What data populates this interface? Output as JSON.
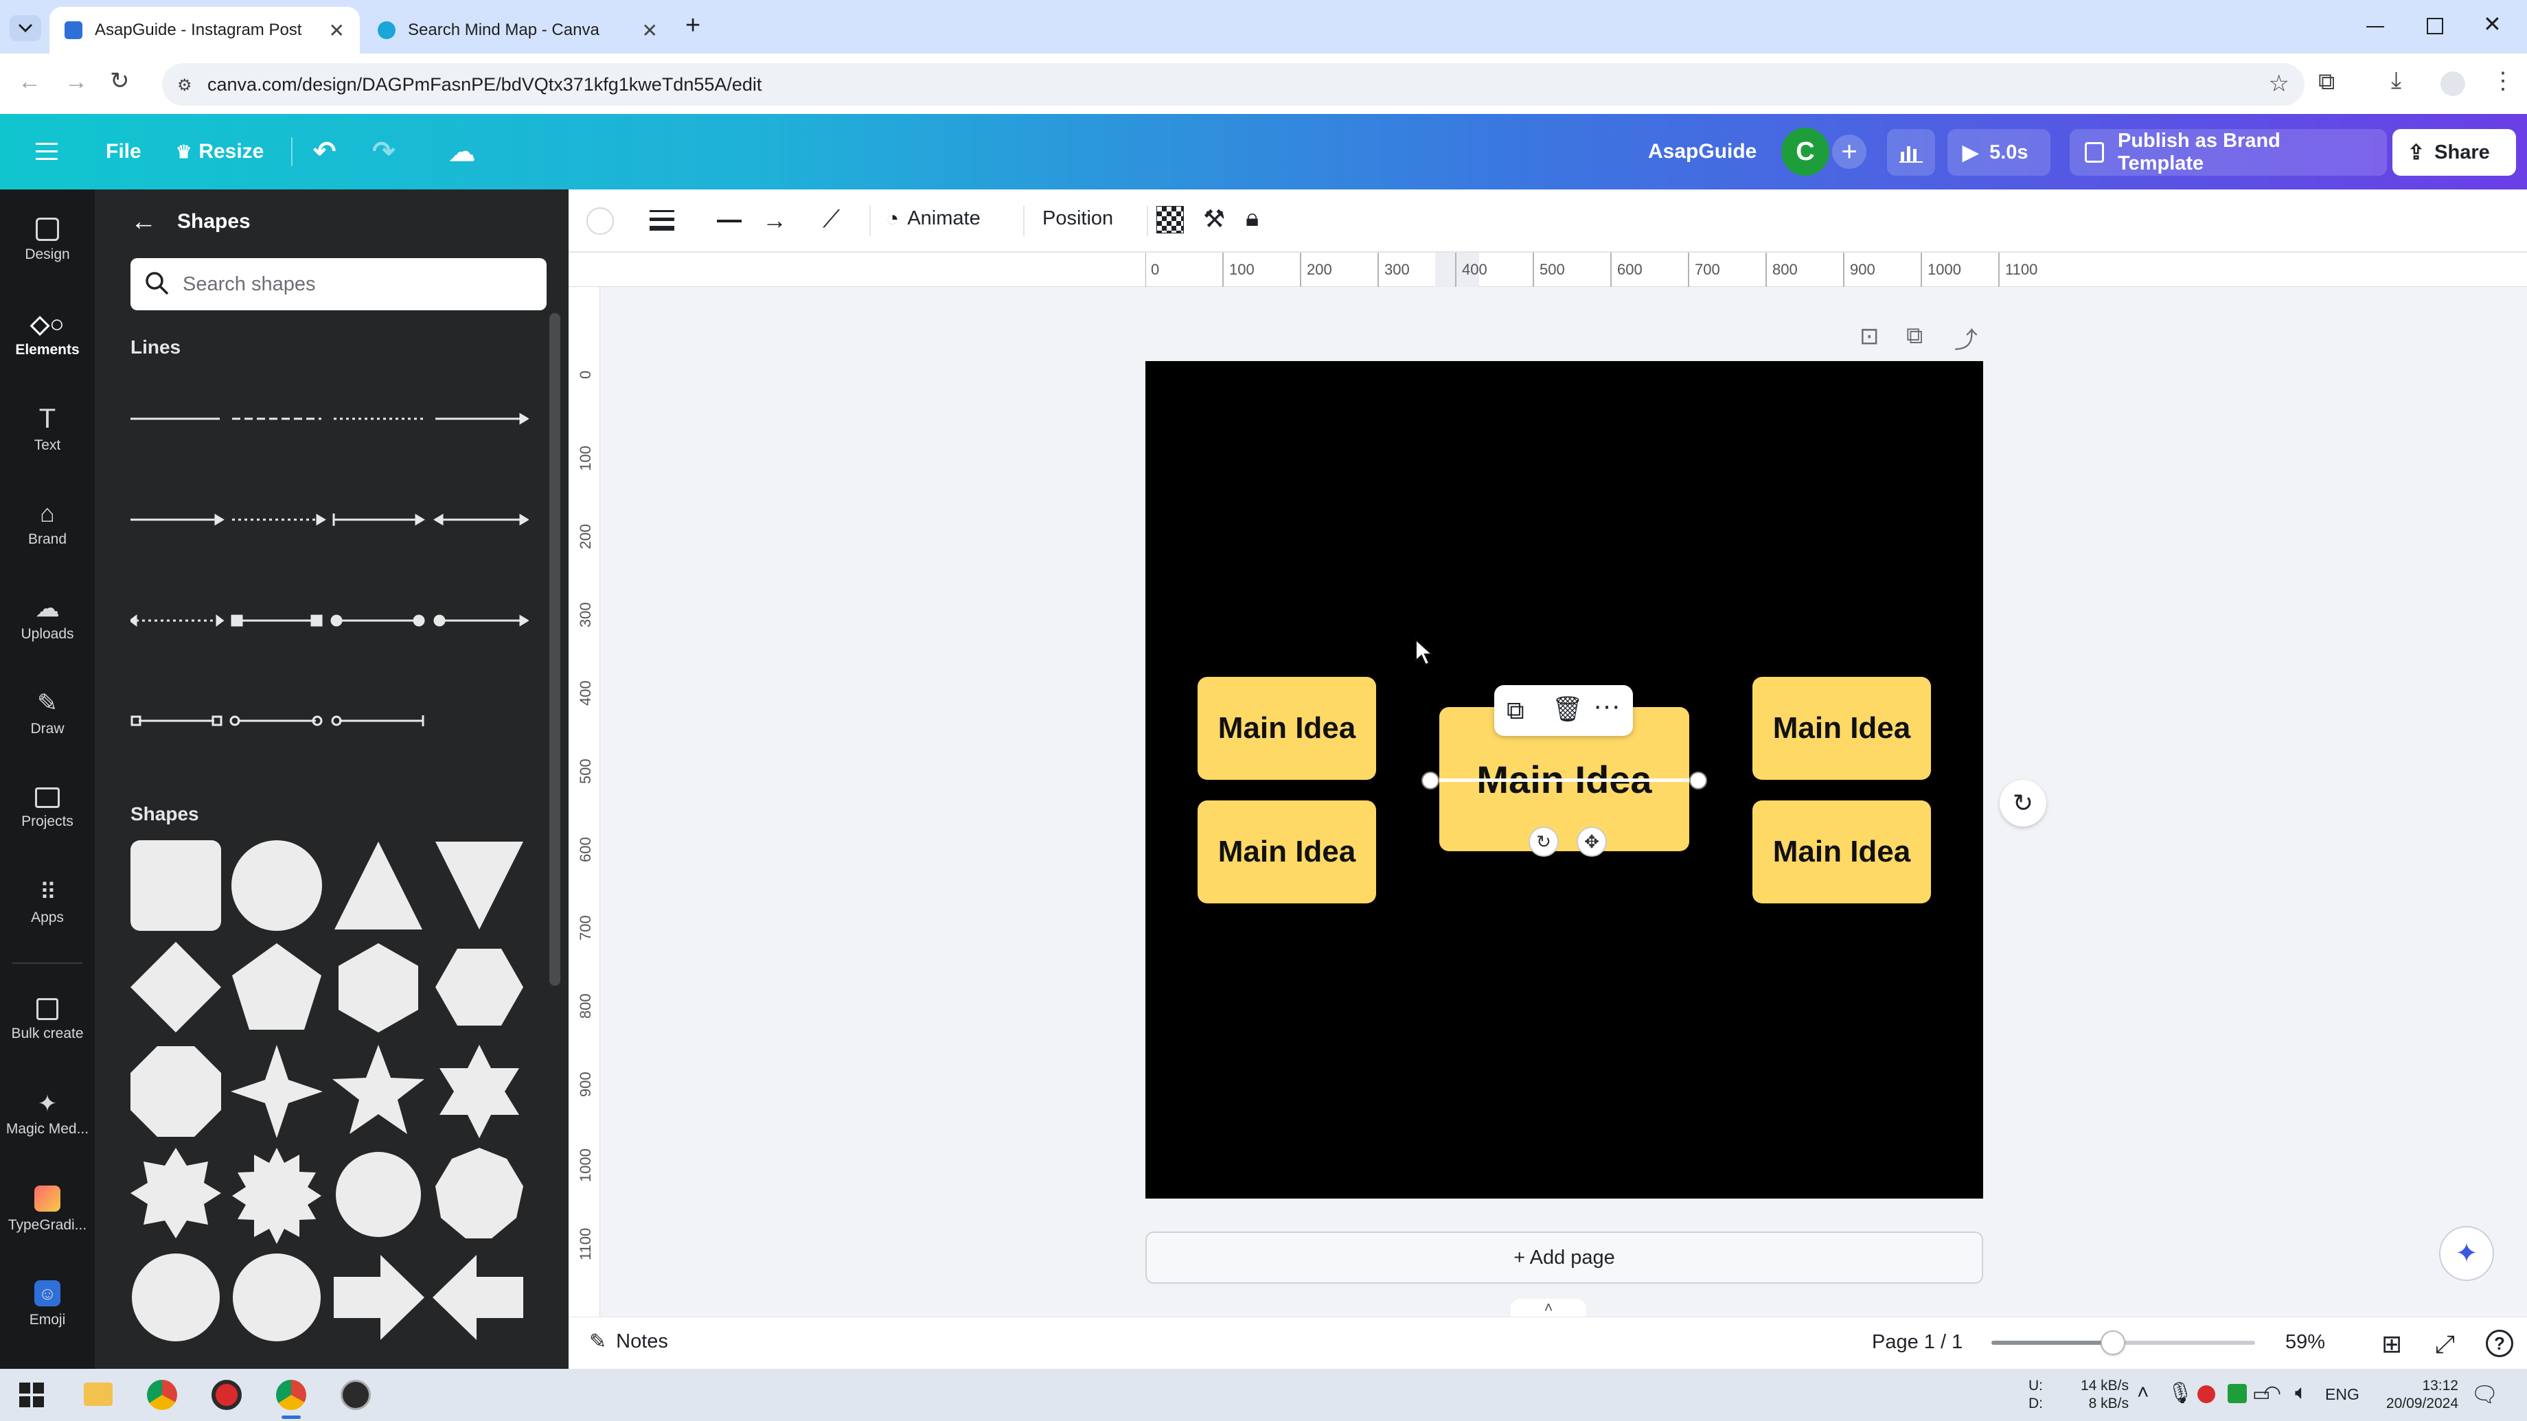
{
  "browser": {
    "tabs": [
      {
        "title": "AsapGuide - Instagram Post",
        "active": true
      },
      {
        "title": "Search Mind Map - Canva",
        "active": false
      }
    ],
    "url": "canva.com/design/DAGPmFasnPE/bdVQtx371kfg1kweTdn55A/edit"
  },
  "header": {
    "menu_icon": "hamburger-icon",
    "file_label": "File",
    "resize_label": "Resize",
    "team_name": "AsapGuide",
    "avatar_letter": "C",
    "avatar_color": "#1e9e3a",
    "duration_label": "5.0s",
    "publish_label": "Publish as Brand Template",
    "share_label": "Share"
  },
  "rail": {
    "items": [
      {
        "label": "Design",
        "icon": "design-icon"
      },
      {
        "label": "Elements",
        "icon": "elements-icon",
        "active": true
      },
      {
        "label": "Text",
        "icon": "text-icon"
      },
      {
        "label": "Brand",
        "icon": "brand-icon"
      },
      {
        "label": "Uploads",
        "icon": "uploads-icon"
      },
      {
        "label": "Draw",
        "icon": "draw-icon"
      },
      {
        "label": "Projects",
        "icon": "projects-icon"
      },
      {
        "label": "Apps",
        "icon": "apps-icon"
      },
      {
        "label": "Bulk create",
        "icon": "bulk-create-icon"
      },
      {
        "label": "Magic Med...",
        "icon": "magic-media-icon"
      },
      {
        "label": "TypeGradi...",
        "icon": "typegradient-icon"
      },
      {
        "label": "Emoji",
        "icon": "emoji-icon"
      }
    ]
  },
  "panel": {
    "title": "Shapes",
    "search_placeholder": "Search shapes",
    "lines_label": "Lines",
    "shapes_label": "Shapes"
  },
  "toolbar": {
    "animate_label": "Animate",
    "position_label": "Position"
  },
  "ruler": {
    "top": [
      "0",
      "100",
      "200",
      "300",
      "400",
      "500",
      "600",
      "700",
      "800",
      "900",
      "1000",
      "1100"
    ],
    "left": [
      "0",
      "100",
      "200",
      "300",
      "400",
      "500",
      "600",
      "700",
      "800",
      "900",
      "1000",
      "1100"
    ]
  },
  "canvas": {
    "background": "#000000",
    "box_color": "#ffd966",
    "boxes": [
      {
        "text": "Main Idea"
      },
      {
        "text": "Main Idea"
      },
      {
        "text": "Main Idea"
      },
      {
        "text": "Main Idea"
      },
      {
        "text": "Main Idea"
      }
    ],
    "add_page_label": "+ Add page"
  },
  "bottom": {
    "notes_label": "Notes",
    "page_indicator": "Page 1 / 1",
    "zoom_label": "59%",
    "zoom_fraction": 0.46
  },
  "taskbar": {
    "net_up_label": "U:",
    "net_down_label": "D:",
    "net_up": "14 kB/s",
    "net_down": "8 kB/s",
    "lang": "ENG",
    "time": "13:12",
    "date": "20/09/2024"
  }
}
